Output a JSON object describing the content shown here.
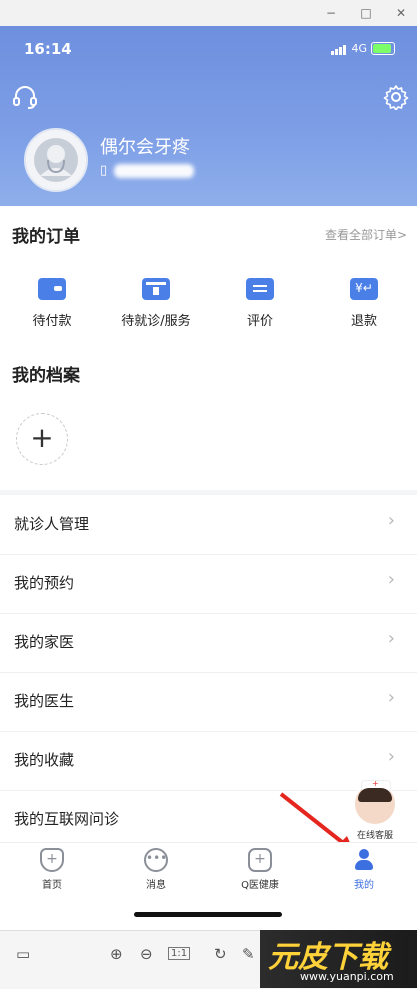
{
  "status_bar": {
    "time": "16:14",
    "network": "4G"
  },
  "header": {
    "username": "偶尔会牙疼"
  },
  "orders": {
    "title": "我的订单",
    "view_all": "查看全部订单>",
    "items": [
      {
        "label": "待付款",
        "icon": "wallet-icon"
      },
      {
        "label": "待就诊/服务",
        "icon": "calendar-icon"
      },
      {
        "label": "评价",
        "icon": "comment-icon"
      },
      {
        "label": "退款",
        "icon": "refund-icon"
      }
    ]
  },
  "files": {
    "title": "我的档案",
    "add_symbol": "+"
  },
  "menu": [
    {
      "label": "就诊人管理"
    },
    {
      "label": "我的预约"
    },
    {
      "label": "我的家医"
    },
    {
      "label": "我的医生"
    },
    {
      "label": "我的收藏"
    },
    {
      "label": "我的互联网问诊"
    }
  ],
  "float_service": {
    "label": "在线客服"
  },
  "tabbar": [
    {
      "label": "首页",
      "icon": "shield-plus-icon"
    },
    {
      "label": "消息",
      "icon": "chat-dots-icon"
    },
    {
      "label": "Q医健康",
      "icon": "health-plus-icon"
    },
    {
      "label": "我的",
      "icon": "user-icon",
      "active": true
    }
  ],
  "toolbar": {
    "zoom_ratio": "1:1"
  },
  "watermark": {
    "brand": "元皮下载",
    "url": "www.yuanpi.com"
  },
  "colors": {
    "accent": "#3c6fe0",
    "header_top": "#6d8fde",
    "arrow": "#e5261f"
  }
}
